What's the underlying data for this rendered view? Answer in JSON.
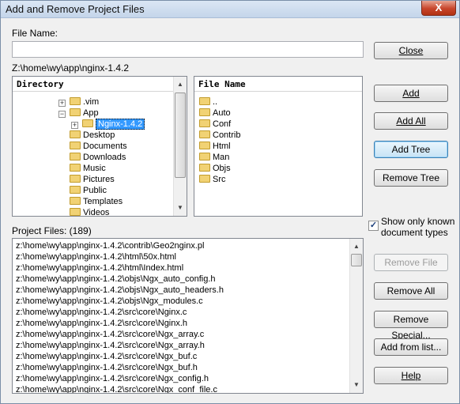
{
  "window": {
    "title": "Add and Remove Project Files",
    "close_glyph": "X"
  },
  "file_name": {
    "label": "File Name:",
    "value": ""
  },
  "current_path": "Z:\\home\\wy\\app\\nginx-1.4.2",
  "directory_panel": {
    "header": "Directory",
    "items": [
      ".vim",
      "App",
      "Nginx-1.4.2",
      "Desktop",
      "Documents",
      "Downloads",
      "Music",
      "Pictures",
      "Public",
      "Templates",
      "Videos"
    ],
    "selected": "Nginx-1.4.2"
  },
  "file_panel": {
    "header": "File Name",
    "items": [
      "..",
      "Auto",
      "Conf",
      "Contrib",
      "Html",
      "Man",
      "Objs",
      "Src"
    ]
  },
  "buttons": {
    "close": "Close",
    "add": "Add",
    "add_all": "Add All",
    "add_tree": "Add Tree",
    "remove_tree": "Remove Tree",
    "remove_file": "Remove File",
    "remove_all": "Remove All",
    "remove_special": "Remove Special...",
    "add_from_list": "Add from list...",
    "help": "Help"
  },
  "show_known": {
    "line1": "Show only known",
    "line2": "document types",
    "checked": true,
    "check_glyph": "✓"
  },
  "project_files": {
    "label": "Project Files: (189)",
    "items": [
      "z:\\home\\wy\\app\\nginx-1.4.2\\contrib\\Geo2nginx.pl",
      "z:\\home\\wy\\app\\nginx-1.4.2\\html\\50x.html",
      "z:\\home\\wy\\app\\nginx-1.4.2\\html\\Index.html",
      "z:\\home\\wy\\app\\nginx-1.4.2\\objs\\Ngx_auto_config.h",
      "z:\\home\\wy\\app\\nginx-1.4.2\\objs\\Ngx_auto_headers.h",
      "z:\\home\\wy\\app\\nginx-1.4.2\\objs\\Ngx_modules.c",
      "z:\\home\\wy\\app\\nginx-1.4.2\\src\\core\\Nginx.c",
      "z:\\home\\wy\\app\\nginx-1.4.2\\src\\core\\Nginx.h",
      "z:\\home\\wy\\app\\nginx-1.4.2\\src\\core\\Ngx_array.c",
      "z:\\home\\wy\\app\\nginx-1.4.2\\src\\core\\Ngx_array.h",
      "z:\\home\\wy\\app\\nginx-1.4.2\\src\\core\\Ngx_buf.c",
      "z:\\home\\wy\\app\\nginx-1.4.2\\src\\core\\Ngx_buf.h",
      "z:\\home\\wy\\app\\nginx-1.4.2\\src\\core\\Ngx_config.h",
      "z:\\home\\wy\\app\\nginx-1.4.2\\src\\core\\Ngx_conf_file.c"
    ]
  },
  "scroll_glyphs": {
    "up": "▲",
    "down": "▼"
  },
  "expanders": {
    "plus": "+",
    "minus": "−"
  }
}
